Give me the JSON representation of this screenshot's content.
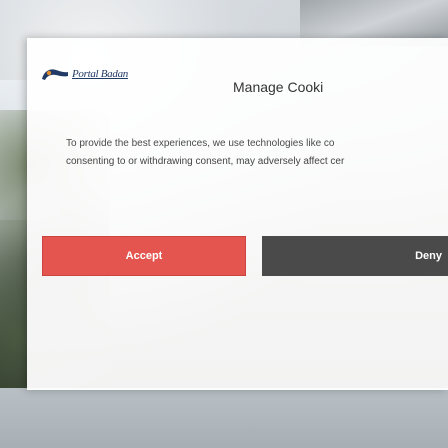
{
  "banner": {
    "logo_text": "Portal Badan",
    "title": "Manage Cooki",
    "description_line1": "To provide the best experiences, we use technologies like co",
    "description_line2": "consenting to or withdrawing consent, may adversely affect cer",
    "accept_label": "Accept",
    "deny_label": "Deny"
  },
  "colors": {
    "accept": "#e4554f",
    "deny": "#4a4a4a",
    "logo": "#223a66"
  },
  "icons": [
    "logo-mark-icon"
  ]
}
